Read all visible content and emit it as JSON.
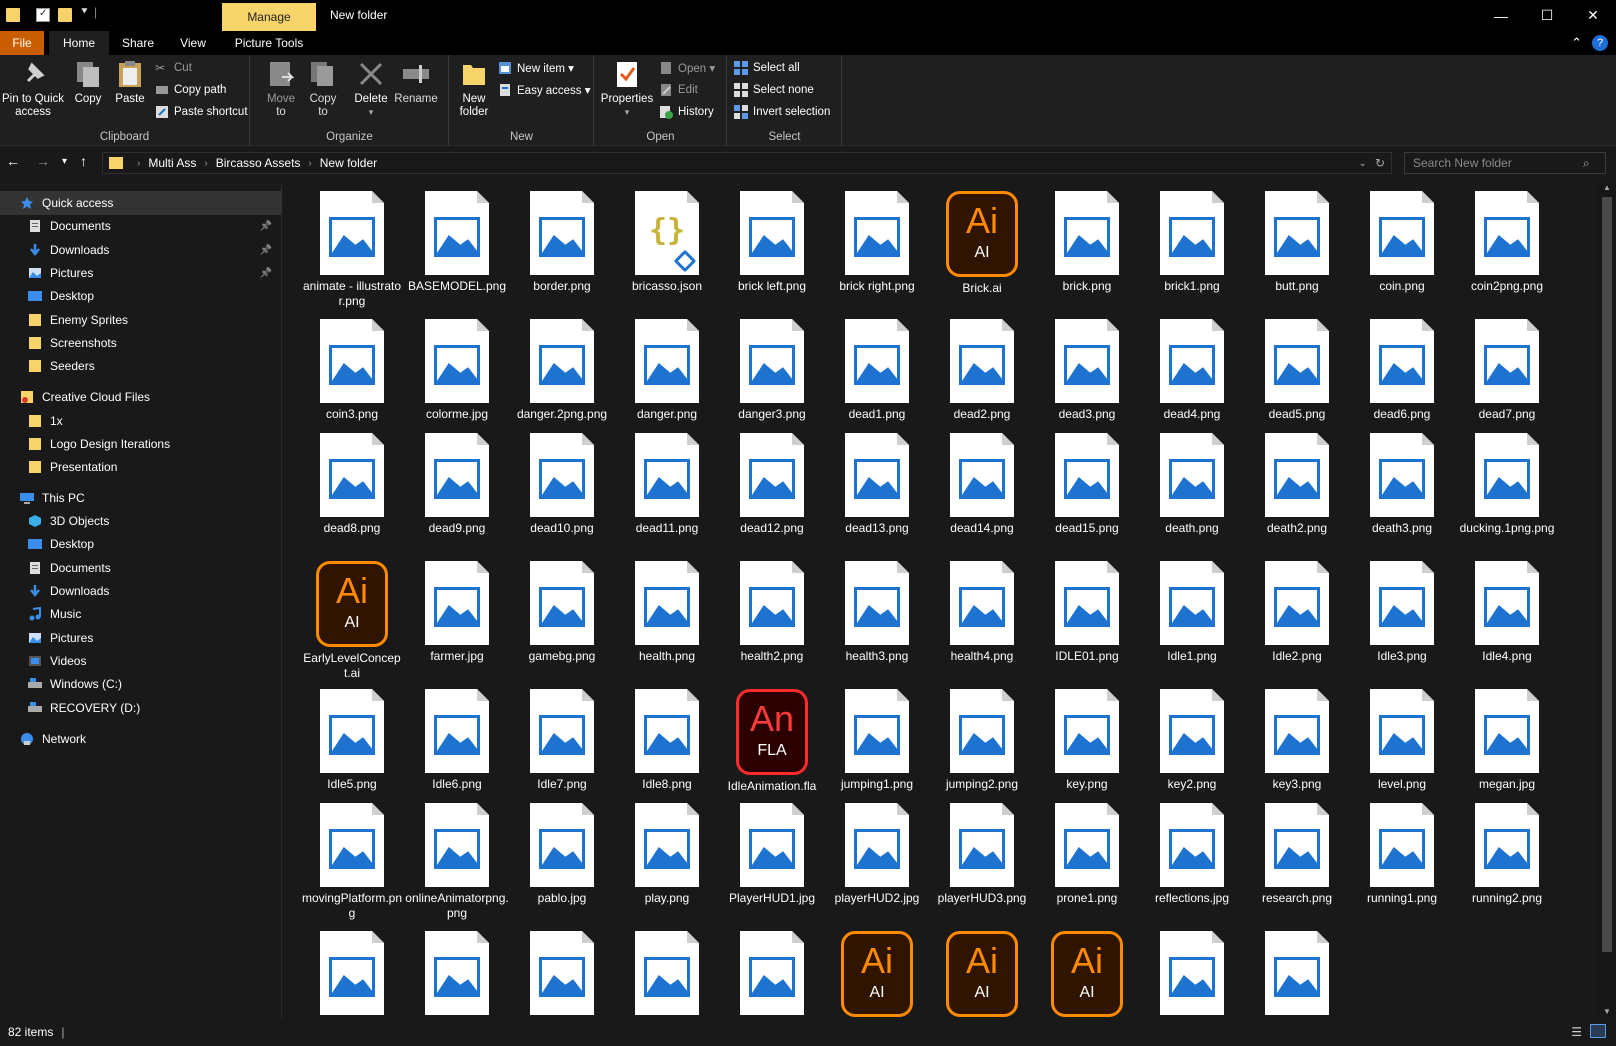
{
  "titlebar": {
    "manage_label": "Manage",
    "window_title": "New folder",
    "minimize": "—",
    "maximize": "☐",
    "close": "✕"
  },
  "menu": {
    "file": "File",
    "home": "Home",
    "share": "Share",
    "view": "View",
    "picture_tools": "Picture Tools",
    "help": "?",
    "collapse": "⌃"
  },
  "ribbon": {
    "clipboard": {
      "label": "Clipboard",
      "pin_line1": "Pin to Quick",
      "pin_line2": "access",
      "copy": "Copy",
      "paste": "Paste",
      "cut": "Cut",
      "copy_path": "Copy path",
      "paste_shortcut": "Paste shortcut"
    },
    "organize": {
      "label": "Organize",
      "move_to_1": "Move",
      "move_to_2": "to",
      "copy_to_1": "Copy",
      "copy_to_2": "to",
      "delete": "Delete",
      "rename": "Rename"
    },
    "new": {
      "label": "New",
      "new_folder_1": "New",
      "new_folder_2": "folder",
      "new_item": "New item ▾",
      "easy_access": "Easy access ▾"
    },
    "open": {
      "label": "Open",
      "properties": "Properties",
      "open": "Open ▾",
      "edit": "Edit",
      "history": "History"
    },
    "select": {
      "label": "Select",
      "select_all": "Select all",
      "select_none": "Select none",
      "invert_selection": "Invert selection"
    }
  },
  "address": {
    "crumbs": [
      "Multi Ass",
      "Bircasso Assets",
      "New folder"
    ],
    "search_placeholder": "Search New folder"
  },
  "nav": {
    "quick_access": "Quick access",
    "items": [
      {
        "label": "Quick access",
        "icon": "star-icon"
      },
      {
        "label": "Documents",
        "icon": "documents-icon",
        "pinned": true
      },
      {
        "label": "Downloads",
        "icon": "download-icon",
        "pinned": true
      },
      {
        "label": "Pictures",
        "icon": "pictures-icon",
        "pinned": true
      },
      {
        "label": "Desktop",
        "icon": "desktop-icon"
      },
      {
        "label": "Enemy Sprites",
        "icon": "folder-icon"
      },
      {
        "label": "Screenshots",
        "icon": "folder-icon"
      },
      {
        "label": "Seeders",
        "icon": "folder-icon"
      },
      {
        "label": "Creative Cloud Files",
        "icon": "creative-cloud-folder-icon"
      },
      {
        "label": "1x",
        "icon": "folder-icon"
      },
      {
        "label": "Logo Design Iterations",
        "icon": "folder-icon"
      },
      {
        "label": "Presentation",
        "icon": "folder-icon"
      },
      {
        "label": "This PC",
        "icon": "pc-icon"
      },
      {
        "label": "3D Objects",
        "icon": "3d-objects-icon"
      },
      {
        "label": "Desktop",
        "icon": "desktop-icon"
      },
      {
        "label": "Documents",
        "icon": "documents-icon"
      },
      {
        "label": "Downloads",
        "icon": "download-icon"
      },
      {
        "label": "Music",
        "icon": "music-icon"
      },
      {
        "label": "Pictures",
        "icon": "pictures-icon"
      },
      {
        "label": "Videos",
        "icon": "videos-icon"
      },
      {
        "label": "Windows (C:)",
        "icon": "drive-icon"
      },
      {
        "label": "RECOVERY (D:)",
        "icon": "drive-icon"
      },
      {
        "label": "Network",
        "icon": "network-icon"
      }
    ]
  },
  "files": [
    {
      "name": "animate - illustrator.png",
      "type": "image"
    },
    {
      "name": "BASEMODEL.png",
      "type": "image"
    },
    {
      "name": "border.png",
      "type": "image"
    },
    {
      "name": "bricasso.json",
      "type": "json"
    },
    {
      "name": "brick left.png",
      "type": "image"
    },
    {
      "name": "brick right.png",
      "type": "image"
    },
    {
      "name": "Brick.ai",
      "type": "ai"
    },
    {
      "name": "brick.png",
      "type": "image"
    },
    {
      "name": "brick1.png",
      "type": "image"
    },
    {
      "name": "butt.png",
      "type": "image"
    },
    {
      "name": "coin.png",
      "type": "image"
    },
    {
      "name": "coin2png.png",
      "type": "image"
    },
    {
      "name": "coin3.png",
      "type": "image"
    },
    {
      "name": "colorme.jpg",
      "type": "image"
    },
    {
      "name": "danger.2png.png",
      "type": "image"
    },
    {
      "name": "danger.png",
      "type": "image"
    },
    {
      "name": "danger3.png",
      "type": "image"
    },
    {
      "name": "dead1.png",
      "type": "image"
    },
    {
      "name": "dead2.png",
      "type": "image"
    },
    {
      "name": "dead3.png",
      "type": "image"
    },
    {
      "name": "dead4.png",
      "type": "image"
    },
    {
      "name": "dead5.png",
      "type": "image"
    },
    {
      "name": "dead6.png",
      "type": "image"
    },
    {
      "name": "dead7.png",
      "type": "image"
    },
    {
      "name": "dead8.png",
      "type": "image"
    },
    {
      "name": "dead9.png",
      "type": "image"
    },
    {
      "name": "dead10.png",
      "type": "image"
    },
    {
      "name": "dead11.png",
      "type": "image"
    },
    {
      "name": "dead12.png",
      "type": "image"
    },
    {
      "name": "dead13.png",
      "type": "image"
    },
    {
      "name": "dead14.png",
      "type": "image"
    },
    {
      "name": "dead15.png",
      "type": "image"
    },
    {
      "name": "death.png",
      "type": "image"
    },
    {
      "name": "death2.png",
      "type": "image"
    },
    {
      "name": "death3.png",
      "type": "image"
    },
    {
      "name": "ducking.1png.png",
      "type": "image"
    },
    {
      "name": "EarlyLevelConcept.ai",
      "type": "ai"
    },
    {
      "name": "farmer.jpg",
      "type": "image"
    },
    {
      "name": "gamebg.png",
      "type": "image"
    },
    {
      "name": "health.png",
      "type": "image"
    },
    {
      "name": "health2.png",
      "type": "image"
    },
    {
      "name": "health3.png",
      "type": "image"
    },
    {
      "name": "health4.png",
      "type": "image"
    },
    {
      "name": "IDLE01.png",
      "type": "image"
    },
    {
      "name": "Idle1.png",
      "type": "image"
    },
    {
      "name": "Idle2.png",
      "type": "image"
    },
    {
      "name": "Idle3.png",
      "type": "image"
    },
    {
      "name": "Idle4.png",
      "type": "image"
    },
    {
      "name": "Idle5.png",
      "type": "image"
    },
    {
      "name": "Idle6.png",
      "type": "image"
    },
    {
      "name": "Idle7.png",
      "type": "image"
    },
    {
      "name": "Idle8.png",
      "type": "image"
    },
    {
      "name": "IdleAnimation.fla",
      "type": "fla"
    },
    {
      "name": "jumping1.png",
      "type": "image"
    },
    {
      "name": "jumping2.png",
      "type": "image"
    },
    {
      "name": "key.png",
      "type": "image"
    },
    {
      "name": "key2.png",
      "type": "image"
    },
    {
      "name": "key3.png",
      "type": "image"
    },
    {
      "name": "level.png",
      "type": "image"
    },
    {
      "name": "megan.jpg",
      "type": "image"
    },
    {
      "name": "movingPlatform.png",
      "type": "image"
    },
    {
      "name": "onlineAnimatorpng.png",
      "type": "image"
    },
    {
      "name": "pablo.jpg",
      "type": "image"
    },
    {
      "name": "play.png",
      "type": "image"
    },
    {
      "name": "PlayerHUD1.jpg",
      "type": "image"
    },
    {
      "name": "playerHUD2.jpg",
      "type": "image"
    },
    {
      "name": "playerHUD3.png",
      "type": "image"
    },
    {
      "name": "prone1.png",
      "type": "image"
    },
    {
      "name": "reflections.jpg",
      "type": "image"
    },
    {
      "name": "research.png",
      "type": "image"
    },
    {
      "name": "running1.png",
      "type": "image"
    },
    {
      "name": "running2.png",
      "type": "image"
    },
    {
      "name": "",
      "type": "image"
    },
    {
      "name": "",
      "type": "image"
    },
    {
      "name": "",
      "type": "image"
    },
    {
      "name": "",
      "type": "image"
    },
    {
      "name": "",
      "type": "image"
    },
    {
      "name": "",
      "type": "ai"
    },
    {
      "name": "",
      "type": "ai"
    },
    {
      "name": "",
      "type": "ai"
    },
    {
      "name": "",
      "type": "image"
    },
    {
      "name": "",
      "type": "image"
    }
  ],
  "status": {
    "count": "82 items"
  },
  "colors": {
    "accent": "#1e73d0",
    "file_tab": "#c85e00",
    "manage_tab": "#f7d46a",
    "ai_orange": "#ff8a00",
    "an_red": "#ff2a2a"
  }
}
